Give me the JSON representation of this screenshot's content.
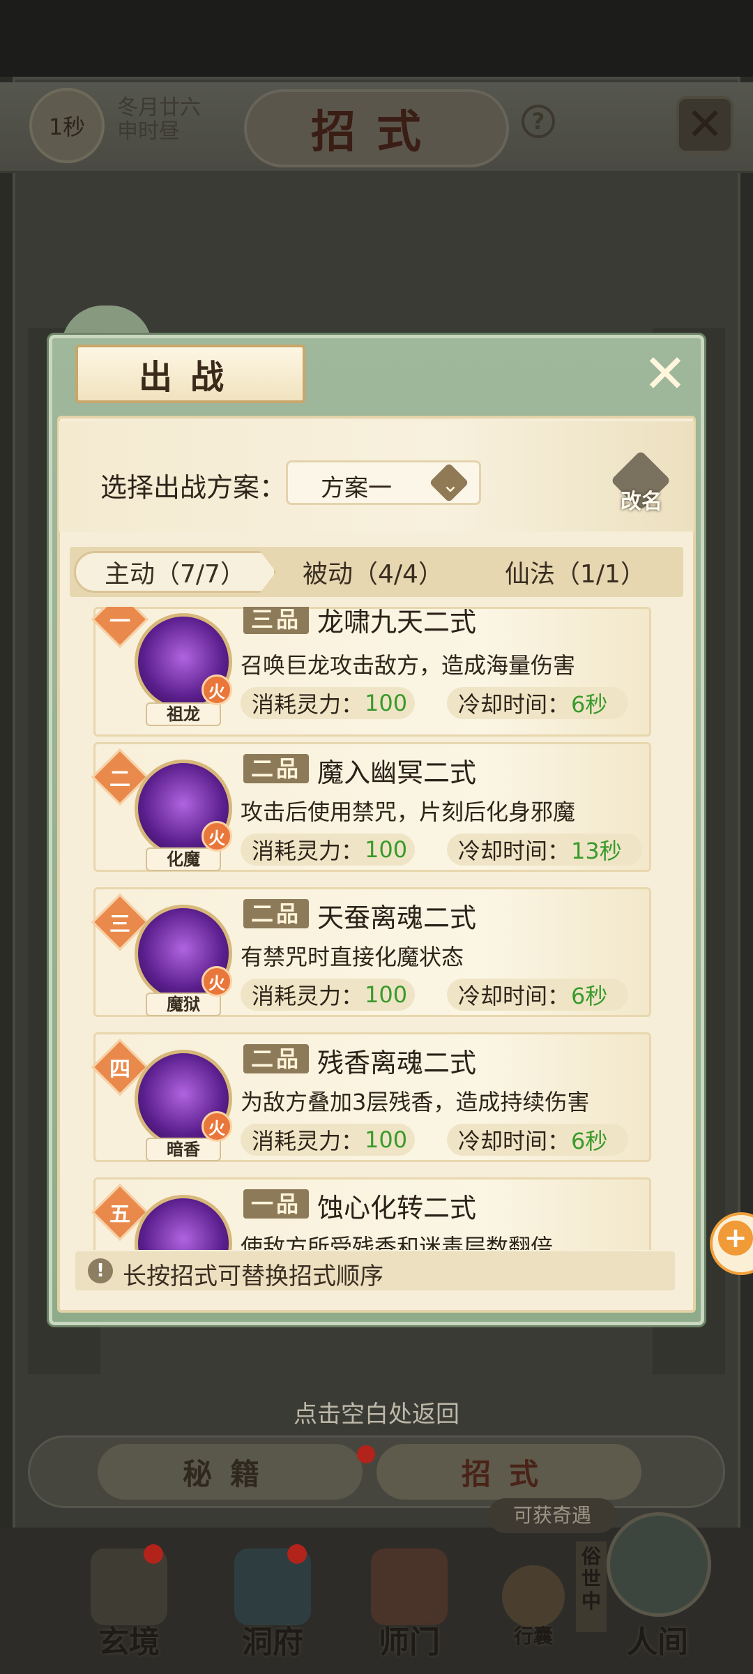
{
  "header": {
    "timer": "1秒",
    "date_line1": "冬月廿六",
    "date_line2": "申时昼",
    "title": "招式",
    "help": "?",
    "close": "✕"
  },
  "modal": {
    "title": "出战",
    "close": "✕",
    "scheme_label": "选择出战方案：",
    "scheme_value": "方案一",
    "rename_label": "改名",
    "tabs": [
      {
        "label": "主动（7/7）",
        "active": true
      },
      {
        "label": "被动（4/4）",
        "active": false
      },
      {
        "label": "仙法（1/1）",
        "active": false
      }
    ],
    "skills": [
      {
        "rank": "一",
        "grade": "三品",
        "name": "龙啸九天二式",
        "icon_label": "祖龙",
        "element": "火",
        "desc": "召唤巨龙攻击敌方，造成海量伤害",
        "cost_label": "消耗灵力：",
        "cost": "100",
        "cd_label": "冷却时间：",
        "cd": "6秒"
      },
      {
        "rank": "二",
        "grade": "二品",
        "name": "魔入幽冥二式",
        "icon_label": "化魔",
        "element": "火",
        "desc": "攻击后使用禁咒，片刻后化身邪魔",
        "cost_label": "消耗灵力：",
        "cost": "100",
        "cd_label": "冷却时间：",
        "cd": "13秒"
      },
      {
        "rank": "三",
        "grade": "二品",
        "name": "天蚕离魂二式",
        "icon_label": "魔狱",
        "element": "火",
        "desc": "有禁咒时直接化魔状态",
        "cost_label": "消耗灵力：",
        "cost": "100",
        "cd_label": "冷却时间：",
        "cd": "6秒"
      },
      {
        "rank": "四",
        "grade": "二品",
        "name": "残香离魂二式",
        "icon_label": "暗香",
        "element": "火",
        "desc": "为敌方叠加3层残香，造成持续伤害",
        "cost_label": "消耗灵力：",
        "cost": "100",
        "cd_label": "冷却时间：",
        "cd": "6秒"
      },
      {
        "rank": "五",
        "grade": "一品",
        "name": "蚀心化转二式",
        "icon_label": "",
        "element": "",
        "desc": "使敌方所受残香和迷毒层数翻倍",
        "cost_label": "",
        "cost": "",
        "cd_label": "",
        "cd": ""
      }
    ],
    "hint": "长按招式可替换招式顺序"
  },
  "bottom": {
    "return_hint": "点击空白处返回",
    "tab_miji": "秘籍",
    "tab_zhaoshi": "招式",
    "event_tag": "可获奇遇",
    "world_tag": "俗世中",
    "nav": [
      "玄境",
      "洞府",
      "师门",
      "行囊",
      "人间"
    ]
  },
  "colors": {
    "accent_green": "#3a9a2c",
    "rank_orange": "#e98a4c",
    "modal_green": "#9fb79a"
  }
}
